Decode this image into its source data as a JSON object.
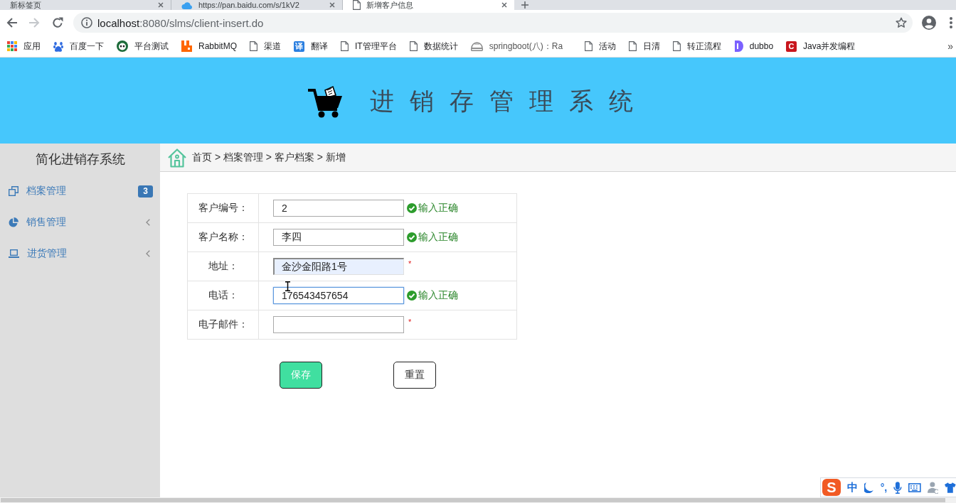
{
  "browser": {
    "tabs": [
      {
        "title": "新标签页",
        "selected": false,
        "kind": "blank"
      },
      {
        "title": "https://pan.baidu.com/s/1kV2",
        "selected": false,
        "kind": "cloud"
      },
      {
        "title": "新增客户信息",
        "selected": true,
        "kind": "page"
      }
    ],
    "toolbar": {
      "forward_disabled": true,
      "url_host": "localhost",
      "url_path": ":8080/slms/client-insert.do"
    },
    "bookmarks": [
      {
        "label": "应用",
        "kind": "apps"
      },
      {
        "label": "百度一下",
        "kind": "paw"
      },
      {
        "label": "平台测试",
        "kind": "circle"
      },
      {
        "label": "RabbitMQ",
        "kind": "block"
      },
      {
        "label": "渠道",
        "kind": "page"
      },
      {
        "label": "翻译",
        "kind": "glyph",
        "glyph": "译",
        "color": "#2b7fe0"
      },
      {
        "label": "IT管理平台",
        "kind": "page"
      },
      {
        "label": "数据统计",
        "kind": "page"
      },
      {
        "label": "springboot(八)：Ra",
        "kind": "helmet"
      },
      {
        "label": "活动",
        "kind": "page"
      },
      {
        "label": "日清",
        "kind": "page"
      },
      {
        "label": "转正流程",
        "kind": "page"
      },
      {
        "label": "dubbo",
        "kind": "bracket"
      },
      {
        "label": "Java并发编程",
        "kind": "glyph",
        "glyph": "C",
        "color": "#c8161d"
      }
    ],
    "bookmarks_overflow": "»"
  },
  "header": {
    "title": "进销存管理系统"
  },
  "sidebar": {
    "title": "简化进销存系统",
    "items": [
      {
        "label": "档案管理",
        "kind": "copy",
        "badge": "3",
        "submenu": false
      },
      {
        "label": "销售管理",
        "kind": "pie",
        "submenu": true
      },
      {
        "label": "进货管理",
        "kind": "laptop",
        "submenu": true
      }
    ]
  },
  "breadcrumb": "首页 > 档案管理 > 客户档案 > 新增",
  "form": {
    "fields": [
      {
        "label": "客户编号：",
        "value": "2",
        "autofilled": false,
        "focused": false,
        "validation": {
          "kind": "ok",
          "text": "输入正确"
        }
      },
      {
        "label": "客户名称：",
        "value": "李四",
        "autofilled": false,
        "focused": false,
        "validation": {
          "kind": "ok",
          "text": "输入正确"
        }
      },
      {
        "label": "地址：",
        "value": "金沙金阳路1号",
        "autofilled": true,
        "focused": false,
        "validation": {
          "kind": "required",
          "text": "*"
        }
      },
      {
        "label": "电话：",
        "value": "176543457654",
        "autofilled": false,
        "focused": true,
        "validation": {
          "kind": "ok",
          "text": "输入正确"
        }
      },
      {
        "label": "电子邮件：",
        "autofilled": false,
        "focused": false,
        "validation": {
          "kind": "required",
          "text": "*"
        }
      }
    ],
    "buttons": [
      {
        "label": "保存",
        "kind": "primary"
      },
      {
        "label": "重置",
        "kind": "default"
      }
    ]
  },
  "ime": {
    "logo": "S",
    "mode": "中",
    "punctuation": "°,"
  }
}
